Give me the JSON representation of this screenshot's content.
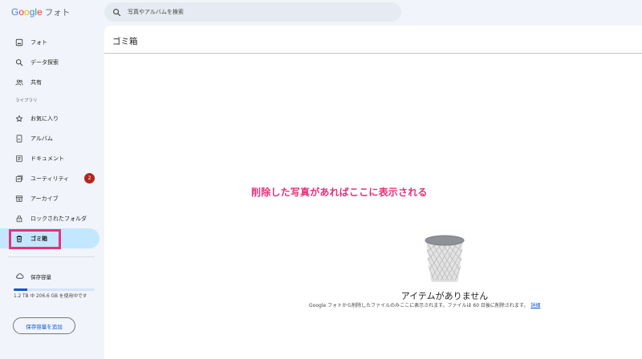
{
  "app": {
    "logo_letters": [
      "G",
      "o",
      "o",
      "g",
      "l",
      "e"
    ],
    "product": "フォト"
  },
  "search": {
    "placeholder": "写真やアルバムを検索"
  },
  "sidebar": {
    "items": [
      {
        "label": "フォト",
        "icon": "photo-icon"
      },
      {
        "label": "データ探索",
        "icon": "search-icon"
      },
      {
        "label": "共有",
        "icon": "people-icon"
      }
    ],
    "library_label": "ライブラリ",
    "library_items": [
      {
        "label": "お気に入り",
        "icon": "star-icon"
      },
      {
        "label": "アルバム",
        "icon": "album-icon"
      },
      {
        "label": "ドキュメント",
        "icon": "document-icon"
      },
      {
        "label": "ユーティリティ",
        "icon": "utilities-icon",
        "badge": "2"
      },
      {
        "label": "アーカイブ",
        "icon": "archive-icon"
      },
      {
        "label": "ロックされたフォルダ",
        "icon": "lock-icon"
      },
      {
        "label": "ゴミ箱",
        "icon": "trash-icon",
        "active": true
      }
    ]
  },
  "storage": {
    "label": "保存容量",
    "usage_text": "1.2 TB 中 206.6 GB を使用中です",
    "used_fraction": 0.17,
    "add_button": "保存容量を追加"
  },
  "main": {
    "title": "ゴミ箱",
    "annotation": "削除した写真があればここに表示される",
    "empty_title": "アイテムがありません",
    "empty_desc": "Google フォトから削除したファイルのみここに表示されます。ファイルは 60 日後に削除されます。",
    "details_link": "詳細"
  },
  "colors": {
    "accent": "#0b57d0",
    "active_bg": "#c2e7ff",
    "badge": "#b3261e",
    "annotation": "#e8317a"
  }
}
